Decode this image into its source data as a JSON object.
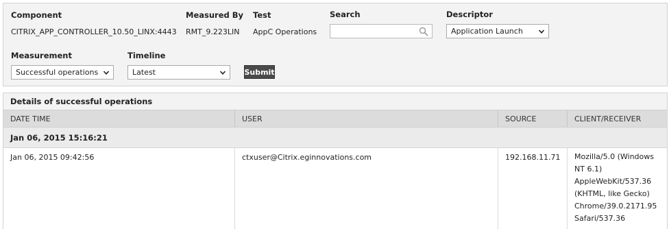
{
  "filters": {
    "component_label": "Component",
    "component_value": "CITRIX_APP_CONTROLLER_10.50_LINX:4443",
    "measured_by_label": "Measured By",
    "measured_by_value": "RMT_9.223LIN",
    "test_label": "Test",
    "test_value": "AppC Operations",
    "search_label": "Search",
    "search_value": "",
    "search_placeholder": "",
    "descriptor_label": "Descriptor",
    "descriptor_value": "Application Launch",
    "measurement_label": "Measurement",
    "measurement_value": "Successful operations",
    "timeline_label": "Timeline",
    "timeline_value": "Latest",
    "submit_label": "Submit"
  },
  "details": {
    "title": "Details of successful operations",
    "columns": [
      "DATE TIME",
      "USER",
      "SOURCE",
      "CLIENT/RECEIVER"
    ],
    "group_header": "Jan 06, 2015 15:16:21",
    "rows": [
      {
        "date_time": "Jan 06, 2015 09:42:56",
        "user": "ctxuser@Citrix.eginnovations.com",
        "source": "192.168.11.71",
        "client_lines": [
          "Mozilla/5.0 (Windows",
          "NT 6.1)",
          "AppleWebKit/537.36",
          "(KHTML, like Gecko)",
          "Chrome/39.0.2171.95",
          "Safari/537.36"
        ]
      }
    ]
  },
  "icons": {
    "search": "search-icon",
    "dropdown": "chevron-down-icon"
  }
}
